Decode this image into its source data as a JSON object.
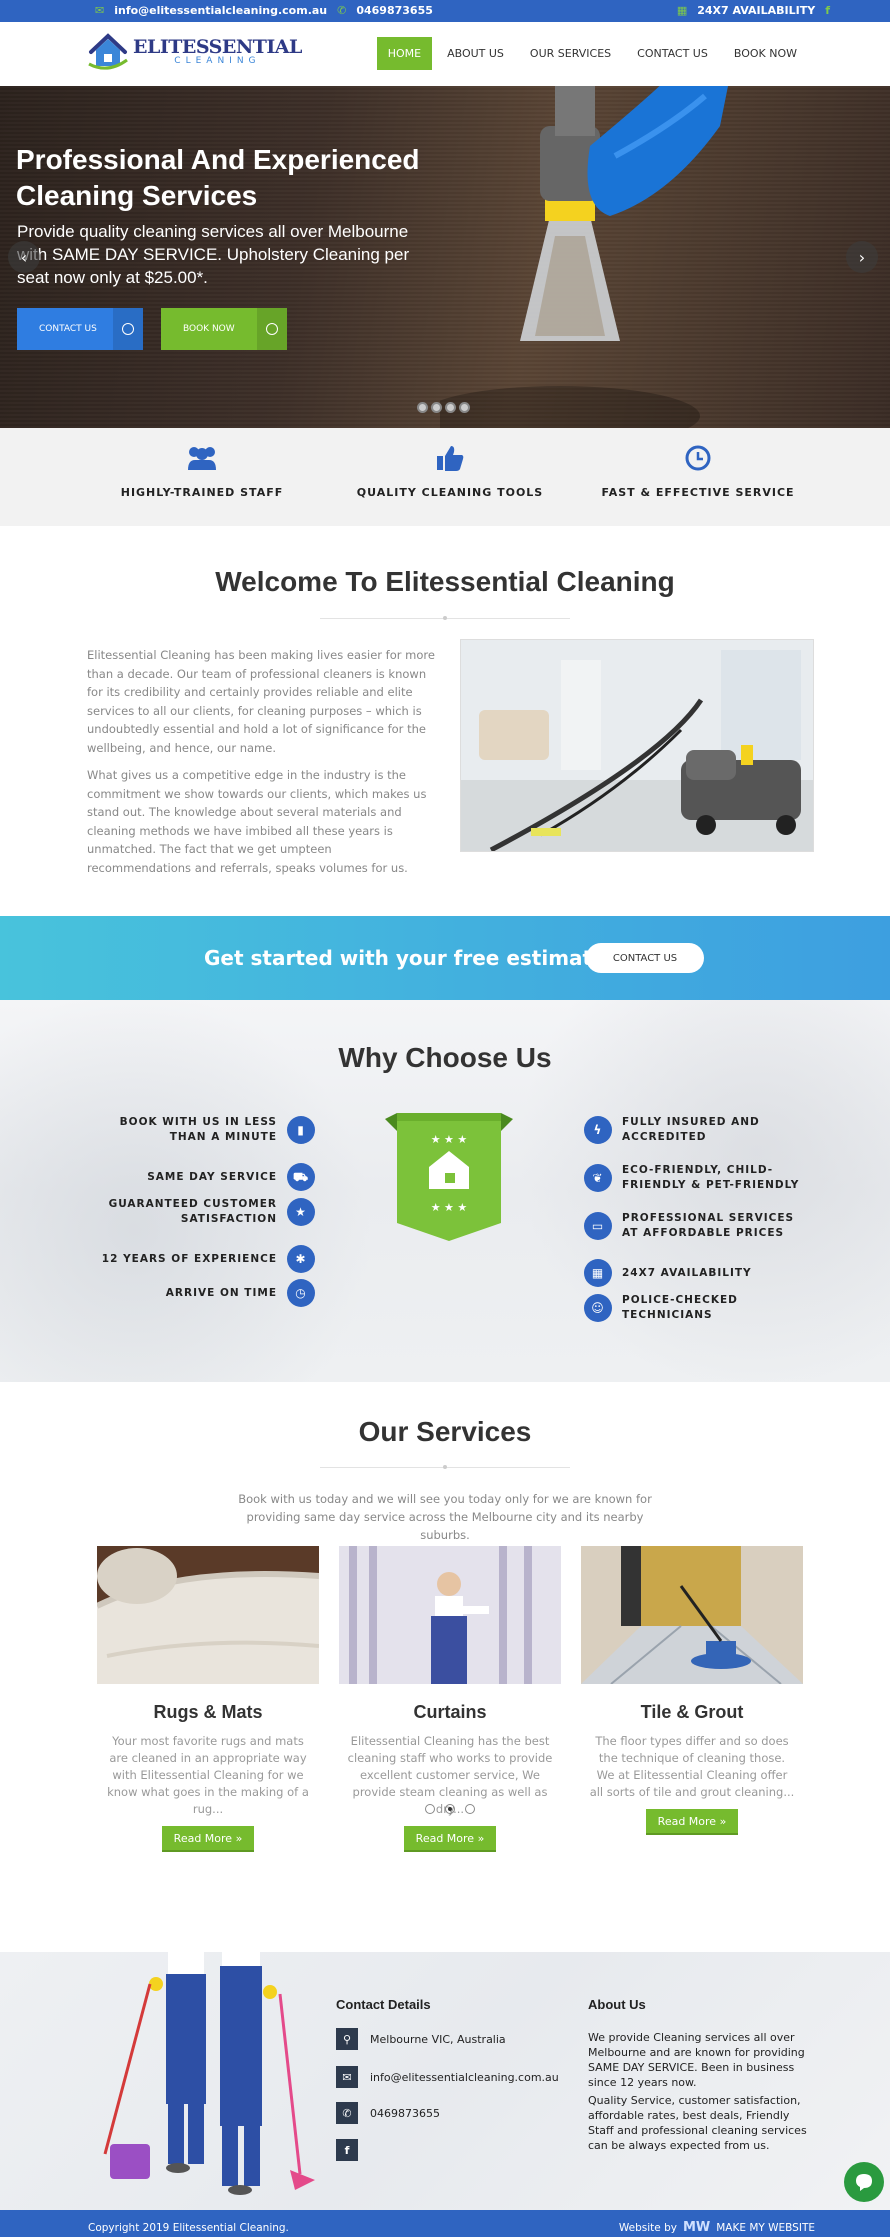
{
  "topbar": {
    "email": "info@elitessentialcleaning.com.au",
    "phone": "0469873655",
    "availability": "24X7 AVAILABILITY"
  },
  "logo": {
    "name": "ELITESSENTIAL",
    "tagline": "CLEANING"
  },
  "nav": [
    {
      "label": "HOME",
      "active": true
    },
    {
      "label": "ABOUT US",
      "active": false
    },
    {
      "label": "OUR SERVICES",
      "active": false
    },
    {
      "label": "CONTACT US",
      "active": false
    },
    {
      "label": "BOOK NOW",
      "active": false
    }
  ],
  "hero": {
    "title": "Professional And Experienced Cleaning Services",
    "text": "Provide quality cleaning services all over Melbourne with SAME DAY SERVICE. Upholstery Cleaning per seat now only at $25.00*.",
    "btn_contact": "CONTACT US",
    "btn_book": "BOOK NOW",
    "slide_count": 4,
    "colors": {
      "blue": "#2f7de1",
      "green": "#76bb2e"
    }
  },
  "features": [
    {
      "icon": "users-icon",
      "label": "HIGHLY-TRAINED STAFF"
    },
    {
      "icon": "thumbs-up-icon",
      "label": "QUALITY CLEANING TOOLS"
    },
    {
      "icon": "clock-icon",
      "label": "FAST & EFFECTIVE SERVICE"
    }
  ],
  "welcome": {
    "title": "Welcome To Elitessential Cleaning",
    "p1": "Elitessential Cleaning has been making lives easier for more than a decade. Our team of professional cleaners is known for its credibility and certainly provides reliable and elite services to all our clients, for cleaning purposes – which is undoubtedly essential and hold a lot of significance for the wellbeing, and hence, our name.",
    "p2": "What gives us a competitive edge in the industry is the commitment we show towards our clients, which makes us stand out. The knowledge about several materials and cleaning methods we have imbibed all these years is unmatched. The fact that we get umpteen recommendations and referrals, speaks volumes for us."
  },
  "cta": {
    "text": "Get started with your free estimate",
    "button": "CONTACT US"
  },
  "why": {
    "title": "Why Choose Us",
    "left": [
      {
        "icon": "bookmark-icon",
        "label": "BOOK WITH US IN LESS THAN A MINUTE"
      },
      {
        "icon": "car-icon",
        "label": "SAME DAY SERVICE"
      },
      {
        "icon": "star-icon",
        "label": "GUARANTEED CUSTOMER SATISFACTION"
      },
      {
        "icon": "badge-icon",
        "label": "12 YEARS OF EXPERIENCE"
      },
      {
        "icon": "clock-icon",
        "label": "ARRIVE ON TIME"
      }
    ],
    "right": [
      {
        "icon": "bolt-icon",
        "label": "FULLY INSURED AND ACCREDITED"
      },
      {
        "icon": "leaf-icon",
        "label": "ECO-FRIENDLY, CHILD-FRIENDLY & PET-FRIENDLY"
      },
      {
        "icon": "money-icon",
        "label": "PROFESSIONAL SERVICES AT AFFORDABLE PRICES"
      },
      {
        "icon": "calendar-icon",
        "label": "24X7 AVAILABILITY"
      },
      {
        "icon": "user-icon",
        "label": "POLICE-CHECKED TECHNICIANS"
      }
    ]
  },
  "services": {
    "title": "Our Services",
    "intro": "Book with us today and we will see you today only for we are known for providing same day service across the Melbourne city and its nearby suburbs.",
    "cards": [
      {
        "title": "Rugs & Mats",
        "desc": "Your most favorite rugs and mats are cleaned in an appropriate way with Elitessential Cleaning for we know what goes in the making of a rug...",
        "btn": "Read More »"
      },
      {
        "title": "Curtains",
        "desc": "Elitessential Cleaning has the best cleaning staff who works to provide excellent customer service, We provide steam cleaning as well as dry...",
        "btn": "Read More »"
      },
      {
        "title": "Tile & Grout",
        "desc": "The floor types differ and so does the technique of cleaning those. We at Elitessential Cleaning offer all sorts of tile and grout cleaning...",
        "btn": "Read More »"
      }
    ]
  },
  "footer": {
    "contact_title": "Contact Details",
    "address": "Melbourne VIC, Australia",
    "email": "info@elitessentialcleaning.com.au",
    "phone": "0469873655",
    "about_title": "About Us",
    "about_p1": "We provide Cleaning services all over Melbourne and are known for providing SAME DAY SERVICE. Been in business since 12 years now.",
    "about_p2": "Quality Service, customer satisfaction, affordable rates, best deals, Friendly Staff and professional cleaning services can be always expected from us."
  },
  "bottom": {
    "copyright": "Copyright 2019 Elitessential Cleaning.",
    "credit_label": "Website by",
    "credit_name": "MAKE MY WEBSITE"
  }
}
